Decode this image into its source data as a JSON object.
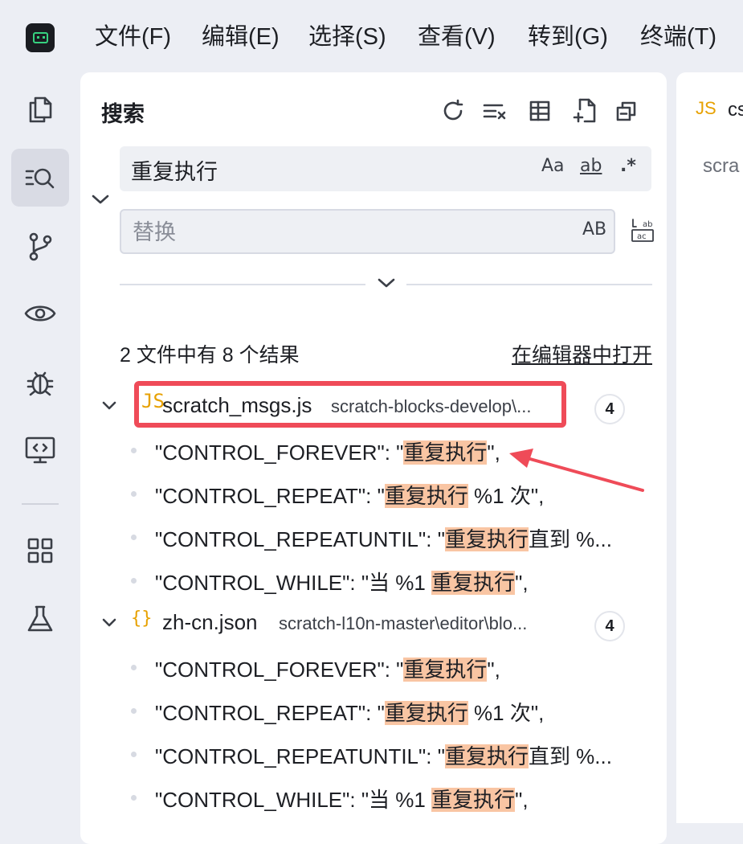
{
  "menu": [
    "文件(F)",
    "编辑(E)",
    "选择(S)",
    "查看(V)",
    "转到(G)",
    "终端(T)"
  ],
  "panel": {
    "title": "搜索",
    "search_value": "重复执行",
    "replace_placeholder": "替换",
    "opt_case": "Aa",
    "opt_word": "ab",
    "opt_regex": ".*",
    "opt_preserve_case": "AB",
    "summary": "2 文件中有 8 个结果",
    "open_in_editor": "在编辑器中打开"
  },
  "results": [
    {
      "icon": "JS",
      "name": "scratch_msgs.js",
      "path": "scratch-blocks-develop\\...",
      "count": "4",
      "matches": [
        {
          "pre": "\"CONTROL_FOREVER\": \"",
          "hit": "重复执行",
          "post": "\","
        },
        {
          "pre": "\"CONTROL_REPEAT\": \"",
          "hit": "重复执行",
          "post": " %1 次\","
        },
        {
          "pre": "\"CONTROL_REPEATUNTIL\": \"",
          "hit": "重复执行",
          "post": "直到 %..."
        },
        {
          "pre": "\"CONTROL_WHILE\": \"当 %1 ",
          "hit": "重复执行",
          "post": "\","
        }
      ]
    },
    {
      "icon": "{}",
      "name": "zh-cn.json",
      "path": "scratch-l10n-master\\editor\\blo...",
      "count": "4",
      "matches": [
        {
          "pre": "\"CONTROL_FOREVER\": \"",
          "hit": "重复执行",
          "post": "\","
        },
        {
          "pre": "\"CONTROL_REPEAT\": \"",
          "hit": "重复执行",
          "post": " %1 次\","
        },
        {
          "pre": "\"CONTROL_REPEATUNTIL\": \"",
          "hit": "重复执行",
          "post": "直到 %..."
        },
        {
          "pre": "\"CONTROL_WHILE\": \"当 %1 ",
          "hit": "重复执行",
          "post": "\","
        }
      ]
    }
  ],
  "editor": {
    "tab_icon": "JS",
    "tab_name": "cs",
    "crumb": "scra"
  },
  "colors": {
    "highlight": "#f9c5a3",
    "annotation": "#ef4b58",
    "js_icon": "#e7a100",
    "logo_green": "#36d17f"
  },
  "icons": {
    "activity": [
      "explorer-icon",
      "search-icon",
      "source-control-icon",
      "eye-icon",
      "debug-icon",
      "remote-icon",
      "extensions-icon",
      "testing-icon"
    ],
    "toolbar": [
      "refresh-icon",
      "clear-results-icon",
      "view-as-tree-icon",
      "new-search-editor-icon",
      "collapse-all-icon"
    ]
  }
}
